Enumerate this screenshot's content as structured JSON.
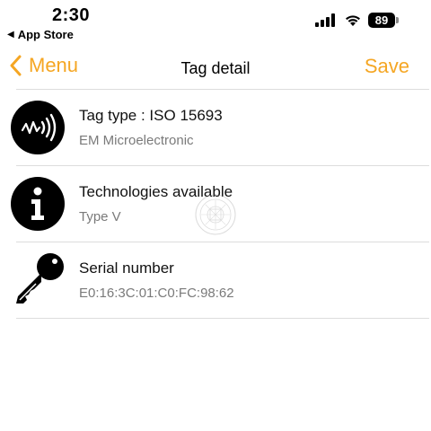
{
  "status_bar": {
    "time": "2:30",
    "back_app_label": "App Store",
    "battery": "89"
  },
  "nav": {
    "back_label": "Menu",
    "title": "Tag detail",
    "save_label": "Save"
  },
  "rows": [
    {
      "title": "Tag type : ISO 15693",
      "subtitle": "EM Microelectronic",
      "icon": "nfc-wave-icon"
    },
    {
      "title": "Technologies available",
      "subtitle": "Type V",
      "icon": "info-icon"
    },
    {
      "title": "Serial number",
      "subtitle": "E0:16:3C:01:C0:FC:98:62",
      "icon": "key-icon"
    }
  ],
  "colors": {
    "accent": "#f5a623",
    "subtitle": "#7a7a7a",
    "divider": "#dddddd"
  }
}
